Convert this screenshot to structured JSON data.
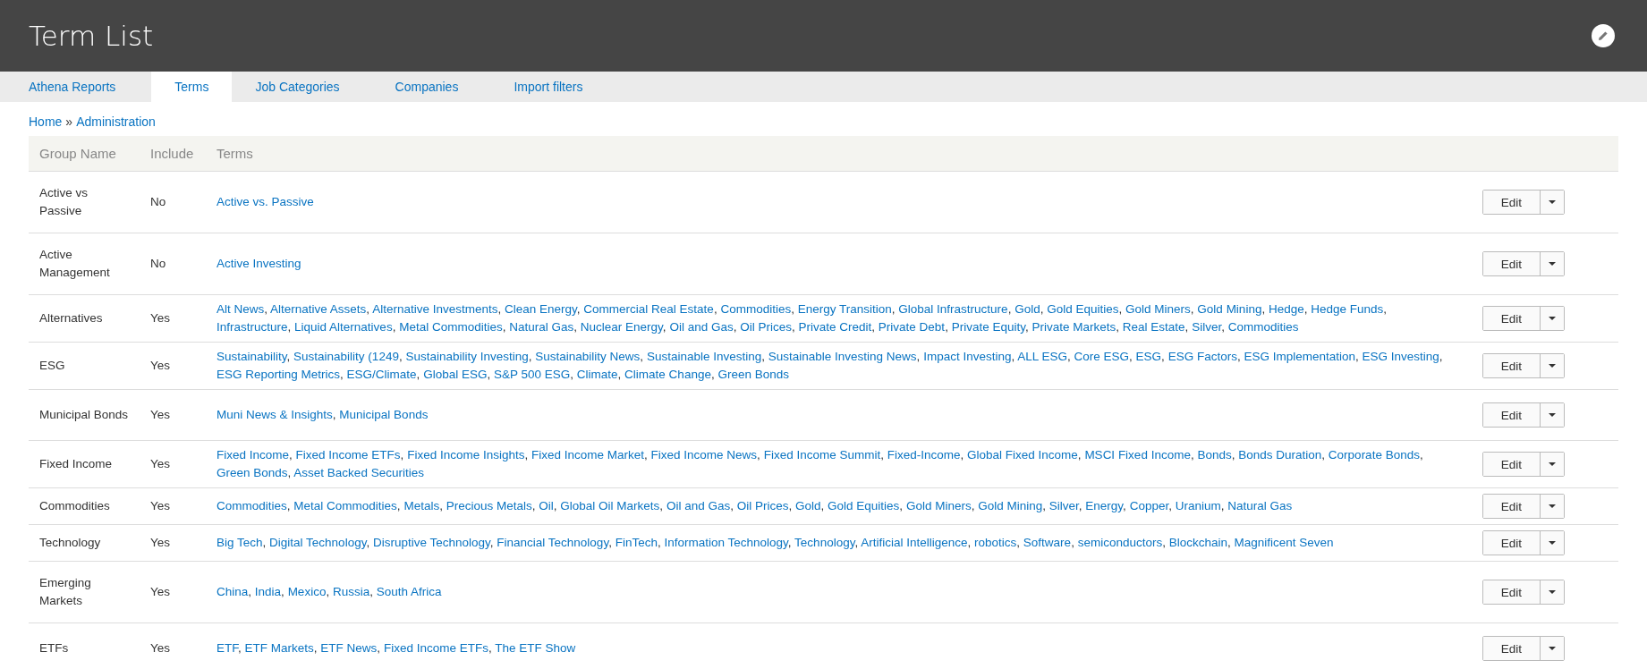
{
  "header": {
    "title": "Term List"
  },
  "tabs": [
    {
      "label": "Athena Reports",
      "selected": false
    },
    {
      "label": "Terms",
      "selected": true
    },
    {
      "label": "Job Categories",
      "selected": false
    },
    {
      "label": "Companies",
      "selected": false
    },
    {
      "label": "Import filters",
      "selected": false
    }
  ],
  "breadcrumb": [
    "Home",
    "Administration"
  ],
  "breadcrumb_separator": "»",
  "table": {
    "columns": [
      "Group Name",
      "Include",
      "Terms"
    ],
    "rows": [
      {
        "group": "Active vs Passive",
        "include": "No",
        "terms": [
          "Active vs. Passive"
        ],
        "action": "Edit"
      },
      {
        "group": "Active Management",
        "include": "No",
        "terms": [
          "Active Investing"
        ],
        "action": "Edit"
      },
      {
        "group": "Alternatives",
        "include": "Yes",
        "terms": [
          "Alt News",
          "Alternative Assets",
          "Alternative Investments",
          "Clean Energy",
          "Commercial Real Estate",
          "Commodities",
          "Energy Transition",
          "Global Infrastructure",
          "Gold",
          "Gold Equities",
          "Gold Miners",
          "Gold Mining",
          "Hedge",
          "Hedge Funds",
          "Infrastructure",
          "Liquid Alternatives",
          "Metal Commodities",
          "Natural Gas",
          "Nuclear Energy",
          "Oil and Gas",
          "Oil Prices",
          "Private Credit",
          "Private Debt",
          "Private Equity",
          "Private Markets",
          "Real Estate",
          "Silver",
          "Commodities"
        ],
        "action": "Edit"
      },
      {
        "group": "ESG",
        "include": "Yes",
        "terms": [
          "Sustainability",
          "Sustainability (1249",
          "Sustainability Investing",
          "Sustainability News",
          "Sustainable Investing",
          "Sustainable Investing News",
          "Impact Investing",
          "ALL ESG",
          "Core ESG",
          "ESG",
          "ESG Factors",
          "ESG Implementation",
          "ESG Investing",
          "ESG Reporting Metrics",
          "ESG/Climate",
          "Global ESG",
          "S&P 500 ESG",
          "Climate",
          "Climate Change",
          "Green Bonds"
        ],
        "action": "Edit"
      },
      {
        "group": "Municipal Bonds",
        "include": "Yes",
        "terms": [
          "Muni News & Insights",
          "Municipal Bonds"
        ],
        "action": "Edit"
      },
      {
        "group": "Fixed Income",
        "include": "Yes",
        "terms": [
          "Fixed Income",
          "Fixed Income ETFs",
          "Fixed Income Insights",
          "Fixed Income Market",
          "Fixed Income News",
          "Fixed Income Summit",
          "Fixed-Income",
          "Global Fixed Income",
          "MSCI Fixed Income",
          "Bonds",
          "Bonds Duration",
          "Corporate Bonds",
          "Green Bonds",
          "Asset Backed Securities"
        ],
        "action": "Edit"
      },
      {
        "group": "Commodities",
        "include": "Yes",
        "terms": [
          "Commodities",
          "Metal Commodities",
          "Metals",
          "Precious Metals",
          "Oil",
          "Global Oil Markets",
          "Oil and Gas",
          "Oil Prices",
          "Gold",
          "Gold Equities",
          "Gold Miners",
          "Gold Mining",
          "Silver",
          "Energy",
          "Copper",
          "Uranium",
          "Natural Gas"
        ],
        "action": "Edit"
      },
      {
        "group": "Technology",
        "include": "Yes",
        "terms": [
          "Big Tech",
          "Digital Technology",
          "Disruptive Technology",
          "Financial Technology",
          "FinTech",
          "Information Technology",
          "Technology",
          "Artificial Intelligence",
          "robotics",
          "Software",
          "semiconductors",
          "Blockchain",
          "Magnificent Seven"
        ],
        "action": "Edit"
      },
      {
        "group": "Emerging Markets",
        "include": "Yes",
        "terms": [
          "China",
          "India",
          "Mexico",
          "Russia",
          "South Africa"
        ],
        "action": "Edit"
      },
      {
        "group": "ETFs",
        "include": "Yes",
        "terms": [
          "ETF",
          "ETF Markets",
          "ETF News",
          "Fixed Income ETFs",
          "The ETF Show"
        ],
        "action": "Edit"
      }
    ]
  },
  "term_separator": ","
}
